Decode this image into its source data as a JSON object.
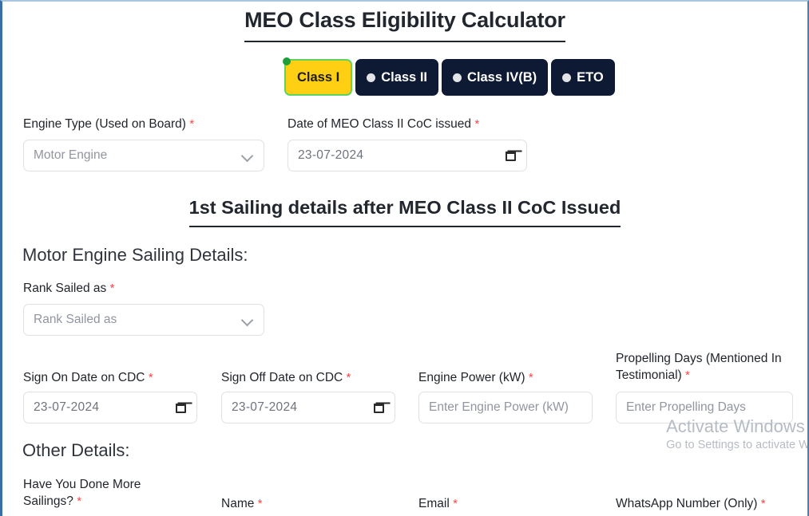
{
  "page": {
    "title": "MEO Class Eligibility Calculator"
  },
  "class_selector": {
    "options": [
      {
        "label": "Class I",
        "selected": true
      },
      {
        "label": "Class II",
        "selected": false
      },
      {
        "label": "Class IV(B)",
        "selected": false
      },
      {
        "label": "ETO",
        "selected": false
      }
    ],
    "selected_color": "#ffcf14",
    "unselected_color": "#0e1a33",
    "selected_border_color": "#5fd35f",
    "selected_dot_color": "#1e9e3a"
  },
  "top_fields": {
    "engine_type": {
      "label": "Engine Type (Used on Board)",
      "required_marker": "*",
      "value": "Motor Engine",
      "icon": "chevron-down-icon"
    },
    "coc_date": {
      "label": "Date of MEO Class II CoC issued",
      "required_marker": "*",
      "value": "23-07-2024",
      "icon": "calendar-icon"
    }
  },
  "sailing_section": {
    "heading": "1st Sailing details after MEO Class II CoC Issued",
    "sub_heading": "Motor Engine Sailing Details:",
    "rank": {
      "label": "Rank Sailed as",
      "required_marker": "*",
      "placeholder": "Rank Sailed as",
      "icon": "chevron-down-icon"
    },
    "sign_on": {
      "label": "Sign On Date on CDC",
      "required_marker": "*",
      "value": "23-07-2024",
      "icon": "calendar-icon"
    },
    "sign_off": {
      "label": "Sign Off Date on CDC",
      "required_marker": "*",
      "value": "23-07-2024",
      "icon": "calendar-icon"
    },
    "engine_power": {
      "label": "Engine Power (kW)",
      "required_marker": "*",
      "placeholder": "Enter Engine Power (kW)"
    },
    "propelling_days": {
      "label": "Propelling Days (Mentioned In Testimonial)",
      "required_marker": "*",
      "placeholder": "Enter Propelling Days"
    }
  },
  "other_details": {
    "sub_heading": "Other Details:",
    "more_sailings": {
      "label": "Have You Done More Sailings?",
      "required_marker": "*"
    },
    "name": {
      "label": "Name",
      "required_marker": "*"
    },
    "email": {
      "label": "Email",
      "required_marker": "*"
    },
    "whatsapp": {
      "label": "WhatsApp Number (Only)",
      "required_marker": "*"
    }
  },
  "watermark": {
    "line1": "Activate Windows",
    "line2": "Go to Settings to activate Windows."
  }
}
